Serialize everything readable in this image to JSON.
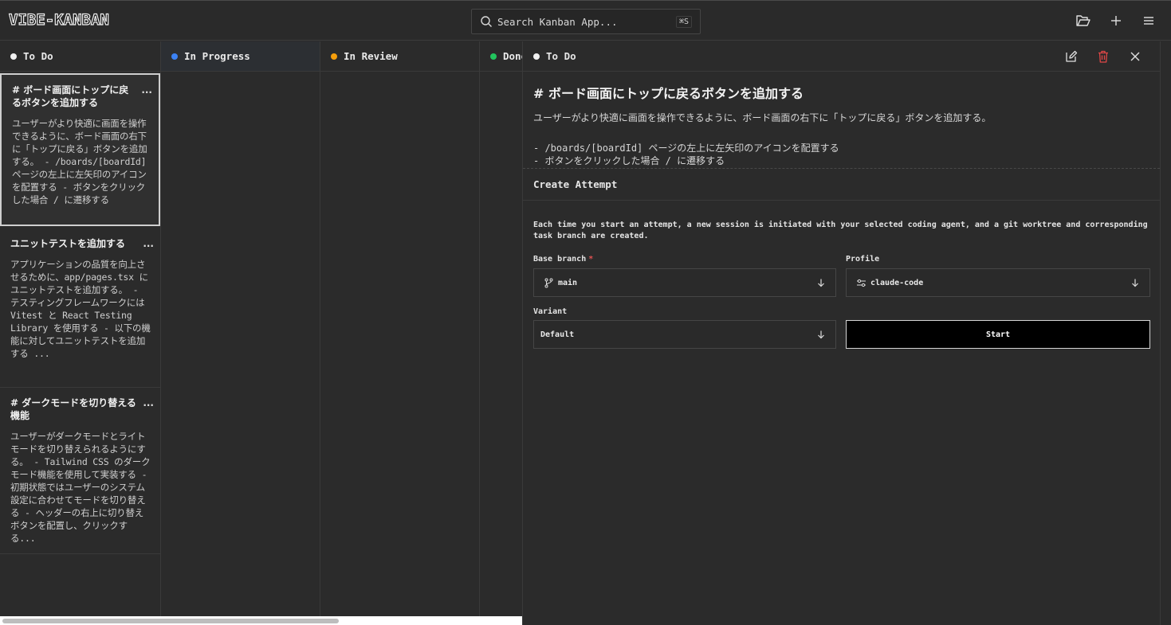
{
  "app": {
    "logo": "VIBE-KANBAN"
  },
  "search": {
    "placeholder": "Search Kanban App...",
    "shortcut": "⌘S"
  },
  "header_icons": [
    "folder-open-icon",
    "plus-icon",
    "menu-icon"
  ],
  "columns": [
    {
      "label": "To Do",
      "color": "#f2f2f2"
    },
    {
      "label": "In Progress",
      "color": "#3b82f6"
    },
    {
      "label": "In Review",
      "color": "#f59e0b"
    },
    {
      "label": "Done",
      "color": "#22c55e"
    }
  ],
  "cards": [
    {
      "title": "# ボード画面にトップに戻るボタンを追加する",
      "more": "...",
      "description": "ユーザーがより快適に画面を操作できるように、ボード画面の右下に「トップに戻る」ボタンを追加する。 - /boards/[boardId] ページの左上に左矢印のアイコンを配置する - ボタンをクリックした場合 / に遷移する"
    },
    {
      "title": "ユニットテストを追加する",
      "more": "...",
      "description": "アプリケーションの品質を向上させるために、app/pages.tsx にユニットテストを追加する。 - テスティングフレームワークには Vitest と React Testing Library を使用する - 以下の機能に対してユニットテストを追加する ..."
    },
    {
      "title": "# ダークモードを切り替える機能",
      "more": "...",
      "description": "ユーザーがダークモードとライトモードを切り替えられるようにする。 - Tailwind CSS のダークモード機能を使用して実装する - 初期状態ではユーザーのシステム設定に合わせてモードを切り替える - ヘッダーの右上に切り替えボタンを配置し、クリックする..."
    }
  ],
  "panel": {
    "status": "To Do",
    "status_color": "#f2f2f2",
    "title": "# ボード画面にトップに戻るボタンを追加する",
    "text": "ユーザーがより快適に画面を操作できるように、ボード画面の右下に「トップに戻る」ボタンを追加する。",
    "list": [
      "- /boards/[boardId] ページの左上に左矢印のアイコンを配置する",
      "- ボタンをクリックした場合 / に遷移する"
    ],
    "attempt": {
      "heading": "Create Attempt",
      "info": "Each time you start an attempt, a new session is initiated with your selected coding agent, and a git worktree and corresponding task branch are created.",
      "base_branch_label": "Base branch",
      "base_branch_required": "*",
      "base_branch_value": "main",
      "profile_label": "Profile",
      "profile_value": "claude-code",
      "variant_label": "Variant",
      "variant_value": "Default",
      "start_label": "Start"
    }
  }
}
